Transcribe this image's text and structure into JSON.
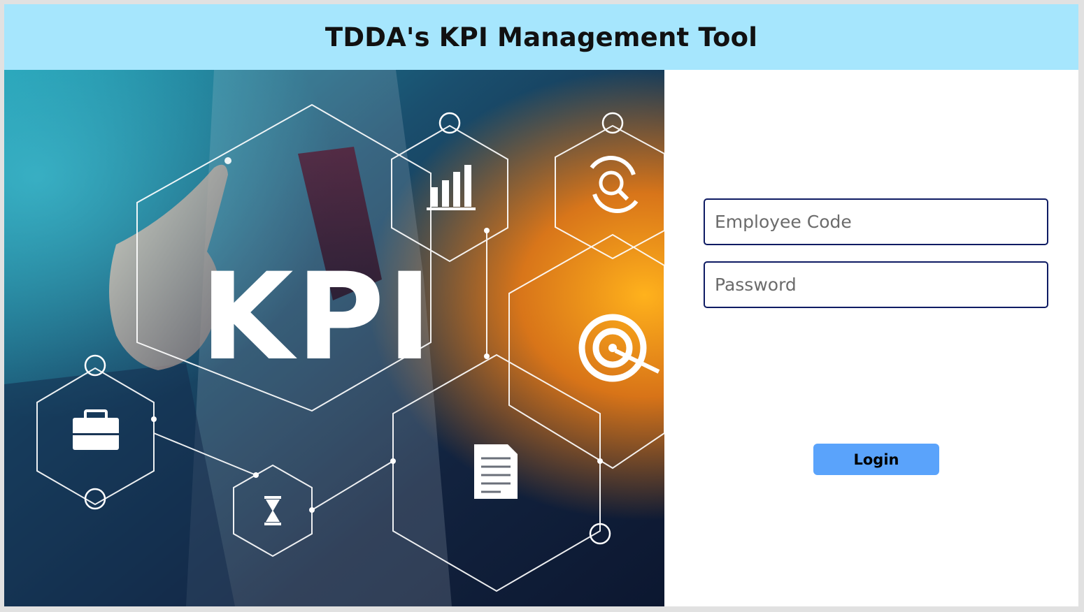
{
  "header": {
    "title": "TDDA's KPI Management Tool"
  },
  "hero": {
    "heading": "KPI",
    "icons": [
      "bar-chart-icon",
      "search-refresh-icon",
      "target-icon",
      "briefcase-icon",
      "hourglass-icon",
      "document-icon"
    ],
    "colors": {
      "teal": "#1f8fa5",
      "navy": "#0f1f3d",
      "orange": "#f08a18"
    }
  },
  "login_form": {
    "employee_code_placeholder": "Employee Code",
    "password_placeholder": "Password",
    "login_label": "Login"
  },
  "colors": {
    "header_bg": "#a6e6fd",
    "field_border": "#0e1b63",
    "button_bg": "#5aa3fb"
  }
}
